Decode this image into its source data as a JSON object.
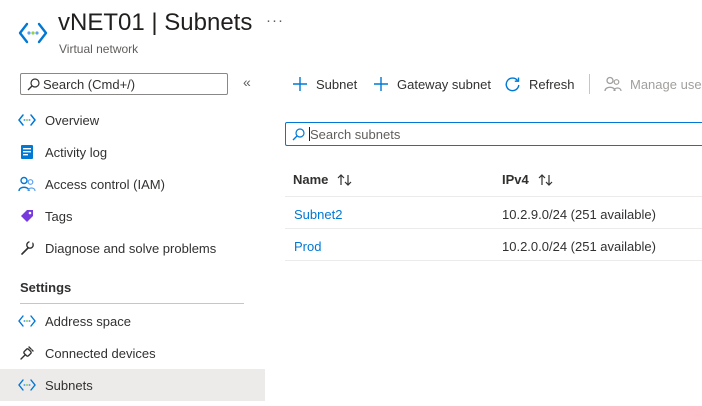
{
  "header": {
    "title": "vNET01 | Subnets",
    "subtitle": "Virtual network",
    "more": "···"
  },
  "sidebar": {
    "search_placeholder": "Search (Cmd+/)",
    "collapse": "«",
    "items": [
      {
        "label": "Overview",
        "icon": "vnet-icon"
      },
      {
        "label": "Activity log",
        "icon": "activity-log-icon"
      },
      {
        "label": "Access control (IAM)",
        "icon": "people-icon"
      },
      {
        "label": "Tags",
        "icon": "tag-icon"
      },
      {
        "label": "Diagnose and solve problems",
        "icon": "wrench-icon"
      }
    ],
    "section": "Settings",
    "settings_items": [
      {
        "label": "Address space",
        "icon": "address-space-icon"
      },
      {
        "label": "Connected devices",
        "icon": "plug-icon"
      },
      {
        "label": "Subnets",
        "icon": "subnets-icon",
        "selected": true
      }
    ]
  },
  "toolbar": {
    "subnet": "Subnet",
    "gateway_subnet": "Gateway subnet",
    "refresh": "Refresh",
    "manage_users": "Manage user"
  },
  "filter": {
    "placeholder": "Search subnets"
  },
  "table": {
    "columns": [
      "Name",
      "IPv4"
    ],
    "rows": [
      {
        "name": "Subnet2",
        "ipv4": "10.2.9.0/24 (251 available)"
      },
      {
        "name": "Prod",
        "ipv4": "10.2.0.0/24 (251 available)"
      }
    ]
  },
  "colors": {
    "accent": "#0078d4",
    "selected_bg": "#edebe9"
  }
}
